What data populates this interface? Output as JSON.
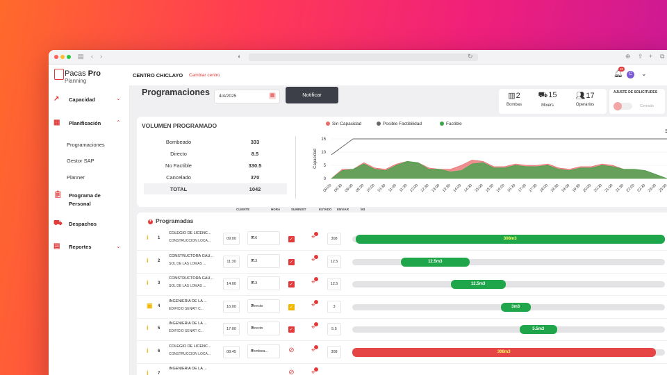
{
  "app": {
    "brand": "Pacas",
    "brand_bold": "Pro",
    "brand_sub": "Planning",
    "centro": "CENTRO CHICLAYO",
    "cambiar": "Cambiar centro",
    "notif_count": "10",
    "avatar": "C"
  },
  "sidebar": {
    "capacidad": "Capacidad",
    "planificacion": "Planificación",
    "programaciones": "Programaciones",
    "gestor": "Gestor SAP",
    "planner": "Planner",
    "programa1": "Programa de",
    "programa2": "Personal",
    "despachos": "Despachos",
    "reportes": "Reportes"
  },
  "header": {
    "title": "Programaciones",
    "date": "4/4/2025",
    "notify": "Notificar",
    "bombas_n": "2",
    "bombas_l": "Bombas",
    "mixers_n": "15",
    "mixers_l": "Mixers",
    "oper_n": "17",
    "oper_l": "Operarios",
    "ajuste": "AJUSTE DE SOLICITUDES",
    "cerrado": "Cerrado"
  },
  "volumen": {
    "title": "VOLUMEN PROGRAMADO",
    "rows": [
      {
        "k": "Bombeado",
        "v": "333"
      },
      {
        "k": "Directo",
        "v": "8.5"
      },
      {
        "k": "No Factible",
        "v": "330.5"
      },
      {
        "k": "Cancelado",
        "v": "370"
      },
      {
        "k": "TOTAL",
        "v": "1042"
      }
    ]
  },
  "chart_data": {
    "type": "area",
    "ylabel": "Capacidad",
    "ylim": [
      0,
      15
    ],
    "yticks": [
      "0",
      "5",
      "10",
      "15"
    ],
    "legend": [
      "Sin Capacidad",
      "Posible Factibilidad",
      "Factible"
    ],
    "colors": {
      "sin": "#e86a6a",
      "posible": "#666666",
      "factible": "#3aa54a"
    },
    "x": [
      "08:00",
      "08:30",
      "09:00",
      "09:30",
      "10:00",
      "10:30",
      "11:00",
      "11:30",
      "12:00",
      "12:30",
      "13:00",
      "13:30",
      "14:00",
      "14:30",
      "15:00",
      "15:30",
      "16:00",
      "16:30",
      "17:00",
      "17:30",
      "18:00",
      "18:30",
      "19:00",
      "19:30",
      "20:00",
      "20:30",
      "21:00",
      "21:30",
      "22:00",
      "22:30",
      "23:00",
      "23:30"
    ],
    "capacity_line": [
      9,
      12,
      15,
      15,
      15,
      15,
      15,
      15,
      15,
      15,
      15,
      15,
      15,
      15,
      15,
      15,
      15,
      15,
      15,
      15,
      15,
      15,
      15,
      15,
      15,
      15,
      15,
      15,
      15,
      15,
      15,
      15
    ],
    "factible": [
      0,
      3,
      3.5,
      5.5,
      3.5,
      3,
      5,
      6.5,
      6,
      3.5,
      3.5,
      2.5,
      3,
      5.5,
      6,
      4,
      4,
      5,
      4.5,
      4.5,
      5,
      3.5,
      3,
      4,
      4,
      5,
      4.5,
      3.5,
      3.5,
      3,
      1.5,
      0
    ],
    "sin_capacidad": [
      0,
      3.5,
      3.5,
      6,
      4,
      3.5,
      5.5,
      6.5,
      6,
      4,
      3.5,
      3.5,
      5,
      7,
      6.5,
      4.5,
      4.5,
      5.5,
      5,
      5,
      5.5,
      4,
      3.5,
      4.5,
      4.5,
      5.5,
      5,
      3.5,
      3.5,
      3,
      1.5,
      0
    ]
  },
  "columns": {
    "cliente": "CLIENTE",
    "hora": "HORA",
    "suminist": "SUMINIST",
    "estado": "ESTADO",
    "enviar": "ENVIAR",
    "m3": "M3"
  },
  "section": "Programadas",
  "rows": [
    {
      "n": "1",
      "c1": "COLEGIO DE LICENC...",
      "c2": "CONSTRUCCION LOCA...",
      "hora": "09:00",
      "sum": "016",
      "m3": "308",
      "bar": "308m3",
      "info": "#f2b800",
      "est": "check",
      "start": 0.01,
      "width": 0.99,
      "color": "#1fa64a",
      "text_color": "#ffff66"
    },
    {
      "n": "2",
      "c1": "CONSTRUCTORA GAU...",
      "c2": "SOL DE LAS LOMAS ...",
      "hora": "11:30",
      "sum": "013",
      "m3": "12.5",
      "bar": "12.5m3",
      "info": "#f2b800",
      "est": "check",
      "start": 0.155,
      "width": 0.22,
      "color": "#1fa64a",
      "text_color": "#ffffff"
    },
    {
      "n": "3",
      "c1": "CONSTRUCTORA GAU...",
      "c2": "SOL DE LAS LOMAS ...",
      "hora": "14:00",
      "sum": "013",
      "m3": "12.5",
      "bar": "12.5m3",
      "info": "#f2b800",
      "est": "check",
      "start": 0.315,
      "width": 0.175,
      "color": "#1fa64a",
      "text_color": "#ffffff"
    },
    {
      "n": "4",
      "c1": "INGENIERIA DE LA ...",
      "c2": "EDIFICIO SENATI C...",
      "hora": "16:00",
      "sum": "Directo",
      "m3": "3",
      "bar": "3m3",
      "info": "#f2b800",
      "est": "check-yellow",
      "start": 0.475,
      "width": 0.095,
      "color": "#1fa64a",
      "text_color": "#ffffff"
    },
    {
      "n": "5",
      "c1": "INGENIERIA DE LA ...",
      "c2": "EDIFICIO SENATI C...",
      "hora": "17:00",
      "sum": "Directo",
      "m3": "5.5",
      "bar": "5.5m3",
      "info": "#f2b800",
      "est": "check",
      "start": 0.535,
      "width": 0.12,
      "color": "#1fa64a",
      "text_color": "#ffffff"
    },
    {
      "n": "6",
      "c1": "COLEGIO DE LICENC...",
      "c2": "CONSTRUCCION LOCA...",
      "hora": "08:45",
      "sum": "Bombea...",
      "m3": "308",
      "bar": "308m3",
      "info": "#f2b800",
      "est": "cancel",
      "start": 0.0,
      "width": 0.97,
      "color": "#e64545",
      "text_color": "#ffff66"
    },
    {
      "n": "7",
      "c1": "INGENIERIA DE LA ...",
      "c2": "",
      "hora": "",
      "sum": "",
      "m3": "",
      "bar": "",
      "info": "#f2b800",
      "est": "cancel",
      "start": 0.0,
      "width": 0.0,
      "color": "#e64545",
      "text_color": "#ffffff"
    }
  ]
}
